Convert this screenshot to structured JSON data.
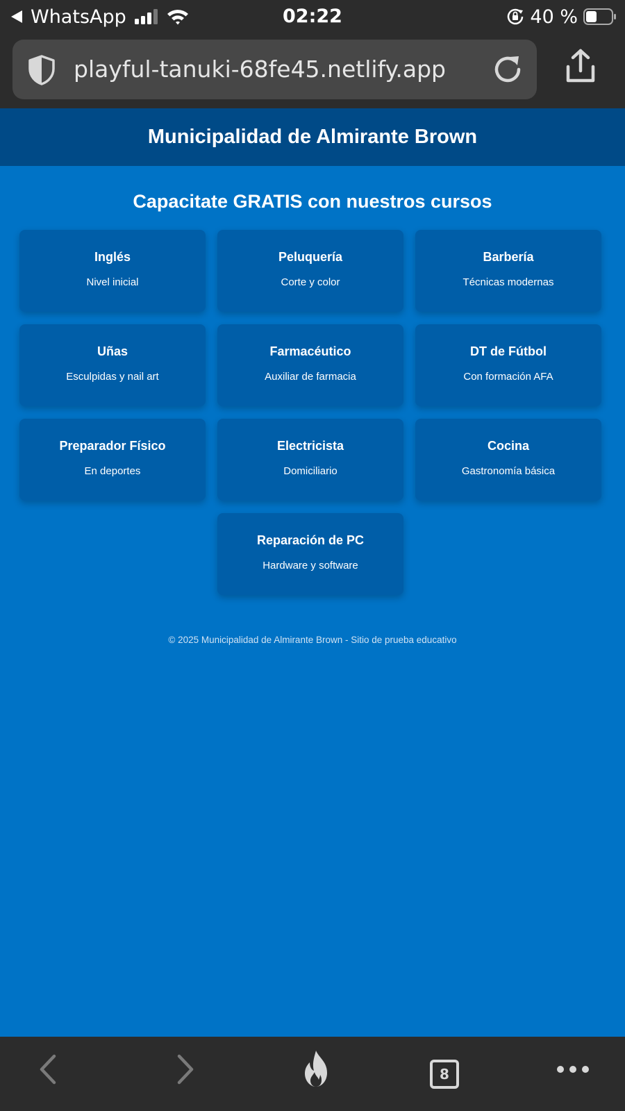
{
  "status_bar": {
    "back_app": "WhatsApp",
    "time": "02:22",
    "battery": "40 %"
  },
  "browser": {
    "url": "playful-tanuki-68fe45.netlify.app",
    "tabs_count": "8"
  },
  "header": {
    "title": "Municipalidad de Almirante Brown"
  },
  "main": {
    "heading": "Capacitate GRATIS con nuestros cursos",
    "courses": [
      {
        "title": "Inglés",
        "desc": "Nivel inicial"
      },
      {
        "title": "Peluquería",
        "desc": "Corte y color"
      },
      {
        "title": "Barbería",
        "desc": "Técnicas modernas"
      },
      {
        "title": "Uñas",
        "desc": "Esculpidas y nail art"
      },
      {
        "title": "Farmacéutico",
        "desc": "Auxiliar de farmacia"
      },
      {
        "title": "DT de Fútbol",
        "desc": "Con formación AFA"
      },
      {
        "title": "Preparador Físico",
        "desc": "En deportes"
      },
      {
        "title": "Electricista",
        "desc": "Domiciliario"
      },
      {
        "title": "Cocina",
        "desc": "Gastronomía básica"
      },
      {
        "title": "Reparación de PC",
        "desc": "Hardware y software"
      }
    ]
  },
  "footer": {
    "text": "© 2025 Municipalidad de Almirante Brown - Sitio de prueba educativo"
  },
  "colors": {
    "page_background": "#0073c6",
    "header_background": "#004a87",
    "card_background": "#005ea8",
    "browser_chrome": "#2c2c2c"
  },
  "icons": [
    "back-arrow-icon",
    "signal-icon",
    "wifi-icon",
    "lock-rotation-icon",
    "battery-icon",
    "shield-icon",
    "reload-icon",
    "share-icon",
    "nav-back-icon",
    "nav-forward-icon",
    "flame-icon",
    "tabs-icon",
    "more-icon"
  ]
}
